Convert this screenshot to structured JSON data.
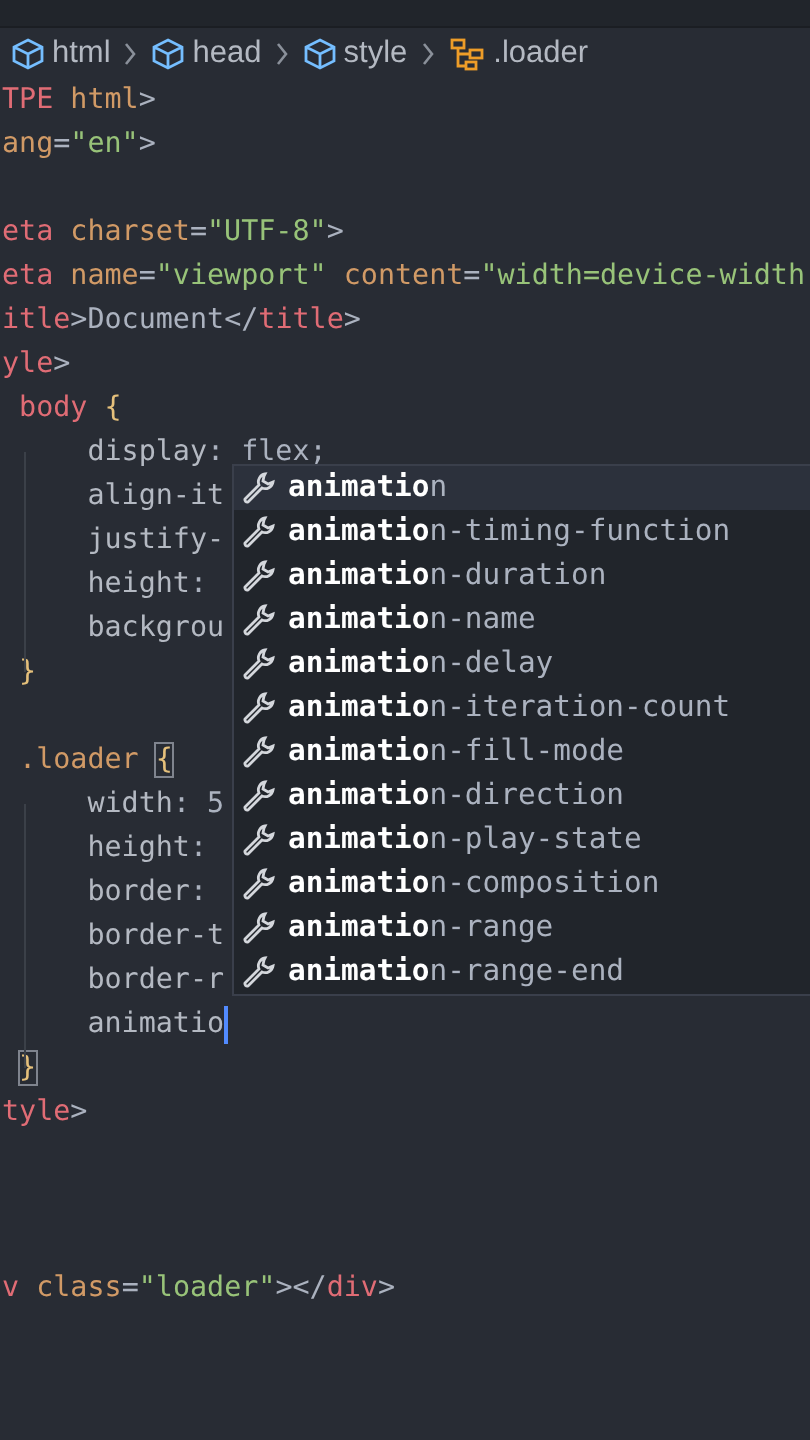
{
  "breadcrumb": [
    {
      "label": "html",
      "kind": "element"
    },
    {
      "label": "head",
      "kind": "element"
    },
    {
      "label": "style",
      "kind": "element"
    },
    {
      "label": ".loader",
      "kind": "class"
    }
  ],
  "code_lines": [
    {
      "kind": "code",
      "tokens": [
        {
          "text": "TPE",
          "kind": "tag"
        },
        {
          "text": " html",
          "kind": "attr"
        },
        {
          "text": ">",
          "kind": "punct"
        }
      ]
    },
    {
      "kind": "code",
      "tokens": [
        {
          "text": "ang",
          "kind": "attr"
        },
        {
          "text": "=",
          "kind": "punct"
        },
        {
          "text": "\"en\"",
          "kind": "string"
        },
        {
          "text": ">",
          "kind": "punct"
        }
      ]
    },
    {
      "kind": "blank"
    },
    {
      "kind": "code",
      "tokens": [
        {
          "text": "eta",
          "kind": "tag"
        },
        {
          "text": " charset",
          "kind": "attr"
        },
        {
          "text": "=",
          "kind": "punct"
        },
        {
          "text": "\"UTF-8\"",
          "kind": "string"
        },
        {
          "text": ">",
          "kind": "punct"
        }
      ]
    },
    {
      "kind": "code",
      "tokens": [
        {
          "text": "eta",
          "kind": "tag"
        },
        {
          "text": " name",
          "kind": "attr"
        },
        {
          "text": "=",
          "kind": "punct"
        },
        {
          "text": "\"viewport\"",
          "kind": "string"
        },
        {
          "text": " content",
          "kind": "attr"
        },
        {
          "text": "=",
          "kind": "punct"
        },
        {
          "text": "\"width=device-width",
          "kind": "string"
        }
      ]
    },
    {
      "kind": "code",
      "tokens": [
        {
          "text": "itle",
          "kind": "tag"
        },
        {
          "text": ">",
          "kind": "punct"
        },
        {
          "text": "Document",
          "kind": "text"
        },
        {
          "text": "</",
          "kind": "punct"
        },
        {
          "text": "title",
          "kind": "tag"
        },
        {
          "text": ">",
          "kind": "punct"
        }
      ]
    },
    {
      "kind": "code",
      "tokens": [
        {
          "text": "yle",
          "kind": "tag"
        },
        {
          "text": ">",
          "kind": "punct"
        }
      ]
    },
    {
      "kind": "code",
      "tokens": [
        {
          "text": " body",
          "kind": "tag"
        },
        {
          "text": " {",
          "kind": "brace"
        }
      ]
    },
    {
      "kind": "code",
      "tokens": [
        {
          "text": "     display",
          "kind": "property"
        },
        {
          "text": ": flex;",
          "kind": "punct"
        }
      ]
    },
    {
      "kind": "code",
      "tokens": [
        {
          "text": "     align-it",
          "kind": "property"
        }
      ]
    },
    {
      "kind": "code",
      "tokens": [
        {
          "text": "     justify-",
          "kind": "property"
        }
      ]
    },
    {
      "kind": "code",
      "tokens": [
        {
          "text": "     height",
          "kind": "property"
        },
        {
          "text": ":",
          "kind": "punct"
        }
      ]
    },
    {
      "kind": "code",
      "tokens": [
        {
          "text": "     backgrou",
          "kind": "property"
        }
      ]
    },
    {
      "kind": "code",
      "tokens": [
        {
          "text": " }",
          "kind": "brace"
        }
      ]
    },
    {
      "kind": "blank"
    },
    {
      "kind": "code",
      "tokens": [
        {
          "text": " .loader",
          "kind": "selector"
        },
        {
          "text": " {",
          "kind": "brace-match"
        }
      ]
    },
    {
      "kind": "code",
      "tokens": [
        {
          "text": "     width",
          "kind": "property"
        },
        {
          "text": ": 5",
          "kind": "punct"
        }
      ]
    },
    {
      "kind": "code",
      "tokens": [
        {
          "text": "     height",
          "kind": "property"
        },
        {
          "text": ":",
          "kind": "punct"
        }
      ]
    },
    {
      "kind": "code",
      "tokens": [
        {
          "text": "     border",
          "kind": "property"
        },
        {
          "text": ":",
          "kind": "punct"
        }
      ]
    },
    {
      "kind": "code",
      "tokens": [
        {
          "text": "     border-t",
          "kind": "property"
        }
      ]
    },
    {
      "kind": "code",
      "tokens": [
        {
          "text": "     border-r",
          "kind": "property"
        }
      ]
    },
    {
      "kind": "code",
      "caret": true,
      "tokens": [
        {
          "text": "     animatio",
          "kind": "property"
        }
      ]
    },
    {
      "kind": "code",
      "tokens": [
        {
          "text": " }",
          "kind": "brace-match"
        }
      ]
    },
    {
      "kind": "code",
      "tokens": [
        {
          "text": "tyle",
          "kind": "tag"
        },
        {
          "text": ">",
          "kind": "punct"
        }
      ]
    },
    {
      "kind": "blank"
    },
    {
      "kind": "blank"
    },
    {
      "kind": "blank"
    },
    {
      "kind": "code",
      "tokens": [
        {
          "text": "v",
          "kind": "tag"
        },
        {
          "text": " class",
          "kind": "attr"
        },
        {
          "text": "=",
          "kind": "punct"
        },
        {
          "text": "\"loader\"",
          "kind": "string"
        },
        {
          "text": "></",
          "kind": "punct"
        },
        {
          "text": "div",
          "kind": "tag"
        },
        {
          "text": ">",
          "kind": "punct"
        }
      ]
    }
  ],
  "suggestions": [
    {
      "match": "animatio",
      "rest": "n",
      "selected": true
    },
    {
      "match": "animatio",
      "rest": "n-timing-function",
      "selected": false
    },
    {
      "match": "animatio",
      "rest": "n-duration",
      "selected": false
    },
    {
      "match": "animatio",
      "rest": "n-name",
      "selected": false
    },
    {
      "match": "animatio",
      "rest": "n-delay",
      "selected": false
    },
    {
      "match": "animatio",
      "rest": "n-iteration-count",
      "selected": false
    },
    {
      "match": "animatio",
      "rest": "n-fill-mode",
      "selected": false
    },
    {
      "match": "animatio",
      "rest": "n-direction",
      "selected": false
    },
    {
      "match": "animatio",
      "rest": "n-play-state",
      "selected": false
    },
    {
      "match": "animatio",
      "rest": "n-composition",
      "selected": false
    },
    {
      "match": "animatio",
      "rest": "n-range",
      "selected": false
    },
    {
      "match": "animatio",
      "rest": "n-range-end",
      "selected": false
    }
  ]
}
